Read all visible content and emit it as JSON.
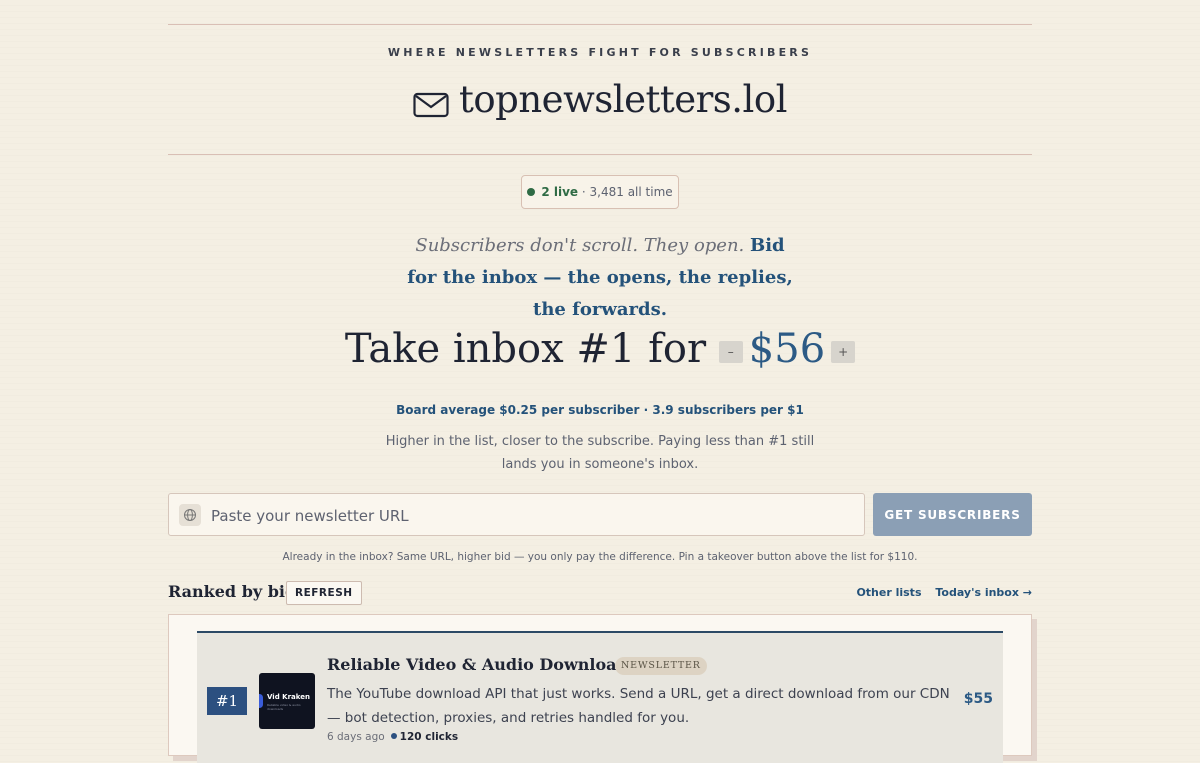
{
  "header": {
    "tagline": "WHERE NEWSLETTERS FIGHT FOR SUBSCRIBERS",
    "brand": "topnewsletters.lol"
  },
  "status": {
    "live_label": "2 live",
    "alltime_label": "· 3,481 all time"
  },
  "pitch": {
    "italic": "Subscribers don't scroll. They open.",
    "bold": "Bid for the inbox — the opens, the replies, the forwards."
  },
  "bid": {
    "prefix": "Take inbox #1 for",
    "decrease_label": "–",
    "price": "$56",
    "increase_label": "+"
  },
  "stats": {
    "average": "Board average $0.25 per subscriber · 3.9 subscribers per $1",
    "hint": "Higher in the list, closer to the subscribe. Paying less than #1 still lands you in someone's inbox."
  },
  "form": {
    "placeholder": "Paste your newsletter URL",
    "submit_label": "GET SUBSCRIBERS",
    "note": "Already in the inbox? Same URL, higher bid — you only pay the difference. Pin a takeover button above the list for $110."
  },
  "list": {
    "heading": "Ranked by bid",
    "refresh_label": "REFRESH",
    "other_lists": "Other lists",
    "todays_inbox": "Today's inbox →",
    "items": [
      {
        "rank": "#1",
        "thumb_name": "Vid Kraken",
        "thumb_sub": "Reliable video & audio downloads",
        "title": "Reliable Video & Audio Downloads",
        "badge": "NEWSLETTER",
        "description": "The YouTube download API that just works. Send a URL, get a direct download from our CDN — bot detection, proxies, and retries handled for you.",
        "age": "6 days ago",
        "clicks": "120 clicks",
        "amount": "$55"
      }
    ]
  },
  "colors": {
    "background": "#f4efe3",
    "accent": "#24527a",
    "live_green": "#2f6b45",
    "button": "#8b9fb5"
  }
}
